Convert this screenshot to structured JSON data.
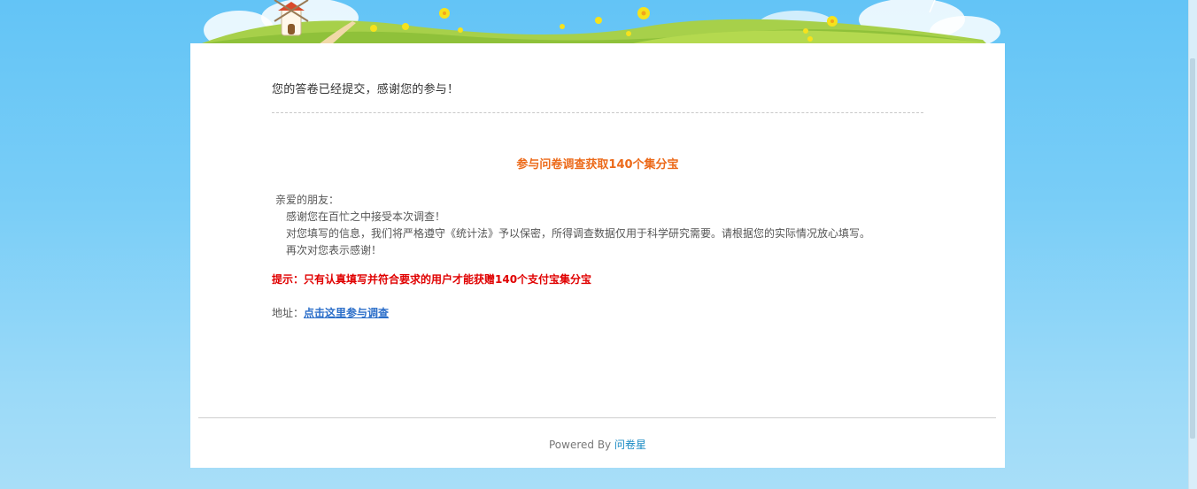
{
  "page": {
    "submitted_message": "您的答卷已经提交，感谢您的参与！",
    "promo_title": "参与问卷调查获取140个集分宝",
    "letter": {
      "greeting": "亲爱的朋友：",
      "lines": [
        "感谢您在百忙之中接受本次调查！",
        "对您填写的信息，我们将严格遵守《统计法》予以保密，所得调查数据仅用于科学研究需要。请根据您的实际情况放心填写。",
        "再次对您表示感谢！"
      ]
    },
    "tip": "提示：只有认真填写并符合要求的用户才能获赠140个支付宝集分宝",
    "address_label": "地址：",
    "address_link": "点击这里参与调查"
  },
  "footer": {
    "powered_by": "Powered By",
    "brand_link": "问卷星"
  },
  "colors": {
    "background_top": "#63c4f6",
    "background_bottom": "#a8def8",
    "promo_title": "#ec6a1a",
    "tip": "#e00000",
    "link": "#2b6ec9",
    "brand_link": "#1a8bc4"
  },
  "icons": {
    "header_scenery": "windmill-meadow-illustration"
  }
}
